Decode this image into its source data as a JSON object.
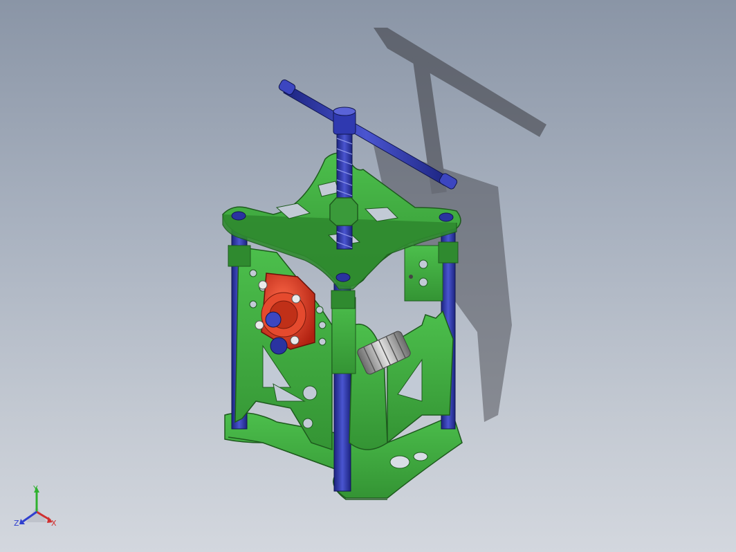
{
  "viewport": {
    "background_top": "#8a95a6",
    "background_bottom": "#d3d7de"
  },
  "model": {
    "frame_color": "#3fa83f",
    "frame_edge_color": "#1e5a1e",
    "rod_color": "#2a33a0",
    "rod_highlight": "#5a63d8",
    "bearing_color": "#d8351f",
    "spring_color": "#b8b8b8"
  },
  "triad": {
    "x_label": "X",
    "y_label": "Y",
    "z_label": "Z",
    "x_color": "#d03030",
    "y_color": "#2fb12f",
    "z_color": "#2f3fcf"
  }
}
